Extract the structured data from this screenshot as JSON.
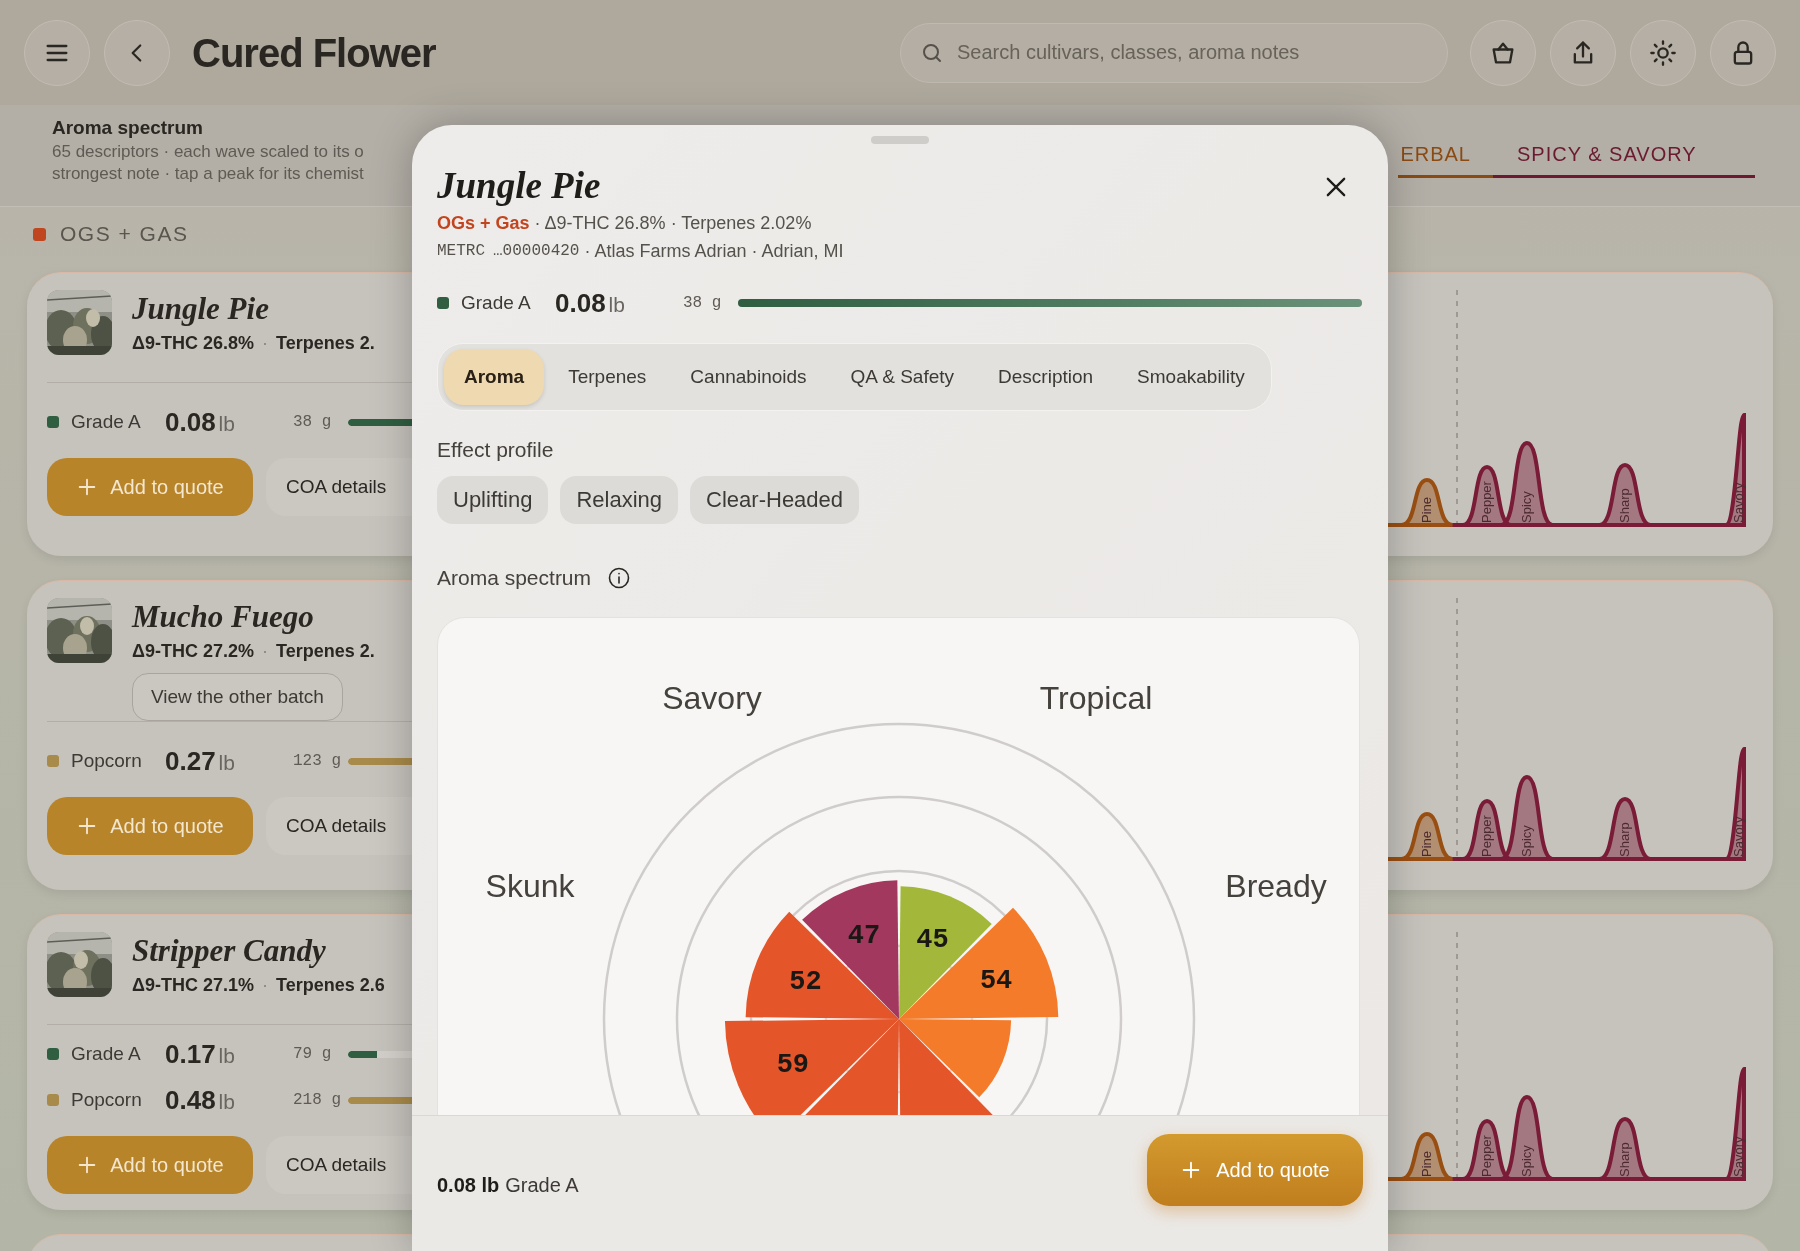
{
  "header": {
    "title": "Cured Flower",
    "search": {
      "placeholder": "Search cultivars, classes, aroma notes"
    }
  },
  "banner": {
    "title": "Aroma spectrum",
    "description_lines": [
      "65 descriptors · each wave scaled to its o",
      "strongest note · tap a peak for its chemist"
    ],
    "categories": [
      {
        "label": "ERBAL",
        "color": "#8a4a12"
      },
      {
        "label": "SPICY & SAVORY",
        "color": "#6b1a30"
      }
    ]
  },
  "section": {
    "title": "OGS + GAS",
    "color": "#c0461f"
  },
  "cards": [
    {
      "name": "Jungle Pie",
      "thc": "Δ9-THC 26.8%",
      "separator": "·",
      "terpenes": "Terpenes 2.",
      "lots": [
        {
          "grade": "Grade A",
          "color": "#2f5e41",
          "weight": "0.08",
          "unit": "lb",
          "grams": "38 g",
          "level": 1
        }
      ],
      "add_button": "Add to quote",
      "coa_button": "COA details",
      "peaks": [
        {
          "label": "Pine",
          "color": "#9a4f12"
        },
        {
          "label": "Pepper",
          "color": "#7a1c38"
        },
        {
          "label": "Spicy",
          "color": "#7a1c38"
        },
        {
          "label": "Sharp",
          "color": "#7a1c38"
        },
        {
          "label": "Savory",
          "color": "#7a1c38"
        }
      ]
    },
    {
      "name": "Mucho Fuego",
      "thc": "Δ9-THC 27.2%",
      "separator": "·",
      "terpenes": "Terpenes 2.",
      "other_batch_button": "View the other batch",
      "lots": [
        {
          "grade": "Popcorn",
          "color": "#a88a4a",
          "weight": "0.27",
          "unit": "lb",
          "grams": "123 g",
          "level": 1
        }
      ],
      "add_button": "Add to quote",
      "coa_button": "COA details",
      "peaks": [
        {
          "label": "Pine",
          "color": "#9a4f12"
        },
        {
          "label": "Pepper",
          "color": "#7a1c38"
        },
        {
          "label": "Spicy",
          "color": "#7a1c38"
        },
        {
          "label": "Sharp",
          "color": "#7a1c38"
        },
        {
          "label": "Savory",
          "color": "#7a1c38"
        }
      ]
    },
    {
      "name": "Stripper Candy",
      "thc": "Δ9-THC 27.1%",
      "separator": "·",
      "terpenes": "Terpenes 2.6",
      "lots": [
        {
          "grade": "Grade A",
          "color": "#2f5e41",
          "weight": "0.17",
          "unit": "lb",
          "grams": "79 g",
          "level": 0.45
        },
        {
          "grade": "Popcorn",
          "color": "#a88a4a",
          "weight": "0.48",
          "unit": "lb",
          "grams": "218 g",
          "level": 1
        }
      ],
      "add_button": "Add to quote",
      "coa_button": "COA details",
      "peaks": [
        {
          "label": "Pine",
          "color": "#9a4f12"
        },
        {
          "label": "Pepper",
          "color": "#7a1c38"
        },
        {
          "label": "Spicy",
          "color": "#7a1c38"
        },
        {
          "label": "Sharp",
          "color": "#7a1c38"
        },
        {
          "label": "Savory",
          "color": "#7a1c38"
        }
      ]
    }
  ],
  "modal": {
    "title": "Jungle Pie",
    "class_label": "OGs + Gas",
    "stats": "· Δ9-THC 26.8% · Terpenes 2.02%",
    "metrc_label": "METRC",
    "metrc_id": "…00000420",
    "source": "· Atlas Farms Adrian · Adrian, MI",
    "lot": {
      "grade": "Grade A",
      "color": "#2f5e41",
      "weight": "0.08",
      "unit": "lb",
      "grams": "38 g",
      "level": 1
    },
    "tabs": [
      {
        "label": "Aroma",
        "selected": true
      },
      {
        "label": "Terpenes",
        "selected": false
      },
      {
        "label": "Cannabinoids",
        "selected": false
      },
      {
        "label": "QA & Safety",
        "selected": false
      },
      {
        "label": "Description",
        "selected": false
      },
      {
        "label": "Smoakability",
        "selected": false
      }
    ],
    "effect_title": "Effect profile",
    "effects": [
      "Uplifting",
      "Relaxing",
      "Clear-Headed"
    ],
    "spectrum_title": "Aroma spectrum",
    "aroma_chart": {
      "axis_labels": [
        "Savory",
        "Tropical",
        "Skunk",
        "Bready"
      ],
      "slices": [
        {
          "label": "45",
          "level": 0.45,
          "color": "#a3b83a"
        },
        {
          "label": "54",
          "level": 0.54,
          "color": "#f47b2a"
        },
        {
          "level": 0.38,
          "color": "#f47b2a"
        },
        {
          "level": 0.5,
          "color": "#e4552a"
        },
        {
          "level": 0.5,
          "color": "#e4552a"
        },
        {
          "label": "59",
          "level": 0.59,
          "color": "#e4552a"
        },
        {
          "label": "52",
          "level": 0.52,
          "color": "#e4552a"
        },
        {
          "label": "47",
          "level": 0.47,
          "color": "#a3385e"
        }
      ]
    },
    "footer": {
      "weight": "0.08 lb",
      "grade": "Grade A",
      "button": "Add to quote"
    }
  }
}
